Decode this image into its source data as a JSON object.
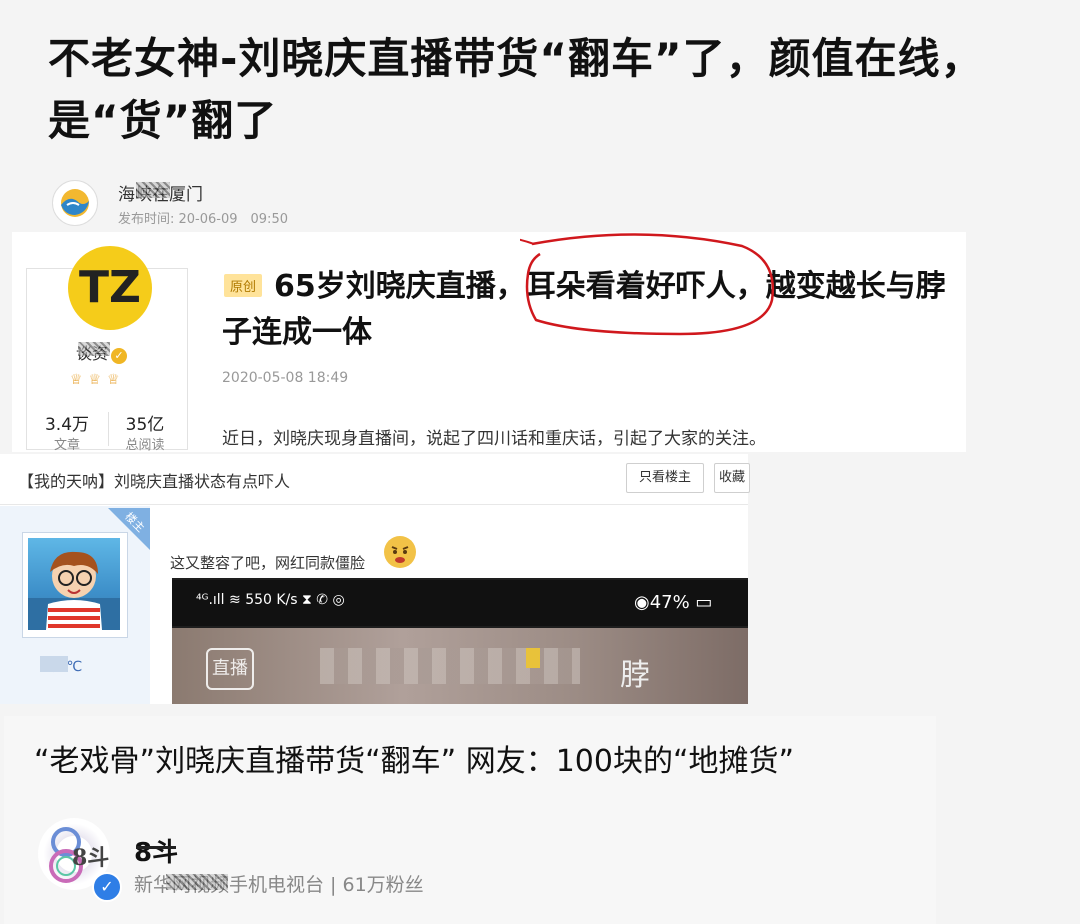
{
  "panel1": {
    "title": "不老女神-刘晓庆直播带货“翻车”了，颜值在线，是“货”翻了",
    "author": "海峡在厦门",
    "time": "发布时间: 20-06-09　09:50"
  },
  "panel2": {
    "avatar_text": "TZ",
    "username": "谈资",
    "crowns": "♕♕♕",
    "stats": [
      {
        "value": "3.4万",
        "label": "文章"
      },
      {
        "value": "35亿",
        "label": "总阅读"
      }
    ],
    "badge": "原创",
    "title": "65岁刘晓庆直播，耳朵看着好吓人，越变越长与脖子连成一体",
    "date": "2020-05-08 18:49",
    "body": "近日，刘晓庆现身直播间，说起了四川话和重庆话，引起了大家的关注。",
    "highlight_color": "#d0181d"
  },
  "panel3": {
    "thread_title": "【我的天呐】刘晓庆直播状态有点吓人",
    "btn_only_owner": "只看楼主",
    "btn_collect": "收藏",
    "ribbon": "楼主",
    "user_name": "N选℃",
    "post_text": "这又整容了吧，网红同款僵脸",
    "status_left": "⁴ᴳ.ıll ≋ 550 K/s ⧗ ✆ ◎",
    "status_right": "◉47% ▭",
    "app_label": "直播",
    "bar_char": "脖"
  },
  "panel4": {
    "title": "“老戏骨”刘晓庆直播带货“翻车” 网友：100块的“地摊货”",
    "logo_text": "8斗",
    "name": "8斗",
    "sub": "新华网视频手机电视台 | 61万粉丝",
    "verified": "✓"
  }
}
